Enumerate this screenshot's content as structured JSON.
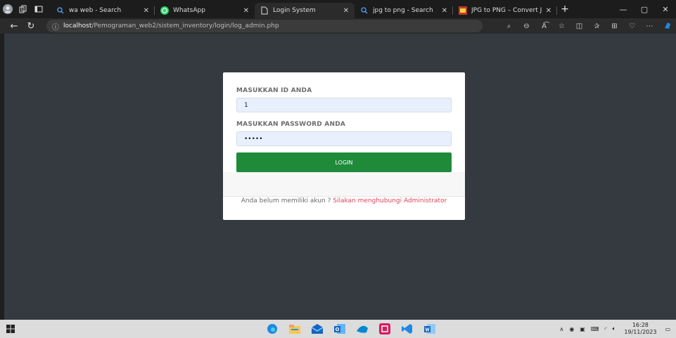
{
  "browser": {
    "tabs": [
      {
        "title": "wa web - Search",
        "icon": "search-icon"
      },
      {
        "title": "WhatsApp",
        "icon": "whatsapp-icon"
      },
      {
        "title": "Login System",
        "icon": "page-icon"
      },
      {
        "title": "jpg to png - Search",
        "icon": "search-icon"
      },
      {
        "title": "JPG to PNG – Convert JPE",
        "icon": "converter-icon"
      }
    ],
    "new_tab_label": "+",
    "address": {
      "host": "localhost",
      "path": "/Pemograman_web2/sistem_inventory/login/log_admin.php"
    }
  },
  "login": {
    "id_label": "MASUKKAN ID ANDA",
    "id_value": "1",
    "password_label": "MASUKKAN PASSWORD ANDA",
    "password_value": "•••••",
    "button_label": "LOGIN",
    "no_account_text": "Anda belum memiliki akun ? ",
    "contact_link": "Silakan menghubungi Administrator"
  },
  "taskbar": {
    "time": "16:28",
    "date": "19/11/2023"
  },
  "colors": {
    "page_bg": "#343a40",
    "login_button": "#1e8a3a",
    "link": "#e0435a",
    "input_bg": "#e8f0fe"
  }
}
